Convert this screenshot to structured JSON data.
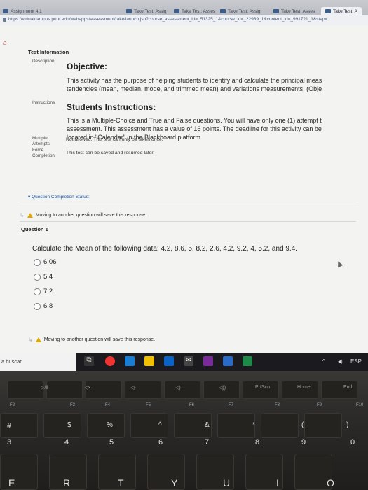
{
  "browser": {
    "tabs": [
      {
        "label": "Assignment 4.1"
      },
      {
        "label": "Take Test: Assig"
      },
      {
        "label": "Take Test: Asses"
      },
      {
        "label": "Take Test: Assig"
      },
      {
        "label": "Take Test: Asses"
      },
      {
        "label": "Take Test: A"
      }
    ],
    "url": "https://virtualcampus.pupr.edu/webapps/assessment/take/launch.jsp?course_assessment_id=_51325_1&course_id=_22939_1&content_id=_991721_1&step="
  },
  "test": {
    "section_title": "Test Information",
    "description_label": "Description",
    "objective_heading": "Objective:",
    "objective_line1": "This activity has the purpose of helping students to identify and calculate the principal meas",
    "objective_line2": "tendencies (mean, median, mode, and trimmed mean) and variations measurements. (Obje",
    "instructions_label": "Instructions",
    "instructions_heading": "Students Instructions:",
    "instructions_line1": "This is a Multiple-Choice and True and False questions. You will have only one (1) attempt t",
    "instructions_line2": "assessment. This assessment has a value of 16 points. The deadline for this activity can be",
    "instructions_line3": "located in \"Calendar\" in the Blackboard platform.",
    "multiple_attempts_label_1": "Multiple",
    "multiple_attempts_label_2": "Attempts",
    "multiple_attempts_value": "Not allowed. This test can only be taken once.",
    "force_completion_label_1": "Force",
    "force_completion_label_2": "Completion",
    "force_completion_value": "This test can be saved and resumed later.",
    "completion_status_link": "Question Completion Status:"
  },
  "warning_text": "Moving to another question will save this response.",
  "question": {
    "label": "Question 1",
    "prompt": "Calculate the Mean of the following data: 4.2, 8.6, 5, 8.2, 2.6, 4.2, 9.2, 4, 5.2, and 9.4.",
    "options": [
      "6.06",
      "5.4",
      "7.2",
      "6.8"
    ]
  },
  "taskbar": {
    "search_text": "a buscar",
    "tray_text": "ESP"
  },
  "keyboard": {
    "fkeys": [
      "F2",
      "F3",
      "F4",
      "F5",
      "F6",
      "F7",
      "F8",
      "F9",
      "F10"
    ],
    "fkey_top": [
      "▷/ǁ",
      "◁×",
      "◁-",
      "◁)",
      "◁))",
      "☼",
      "PrtScn",
      "Home",
      "End"
    ],
    "symbols": [
      "#",
      "$",
      "%",
      "^",
      "&",
      "*",
      "(",
      ")"
    ],
    "numbers": [
      "3",
      "4",
      "5",
      "6",
      "7",
      "8",
      "9",
      "0"
    ],
    "letters": [
      "E",
      "R",
      "T",
      "Y",
      "U",
      "I",
      "O"
    ]
  }
}
